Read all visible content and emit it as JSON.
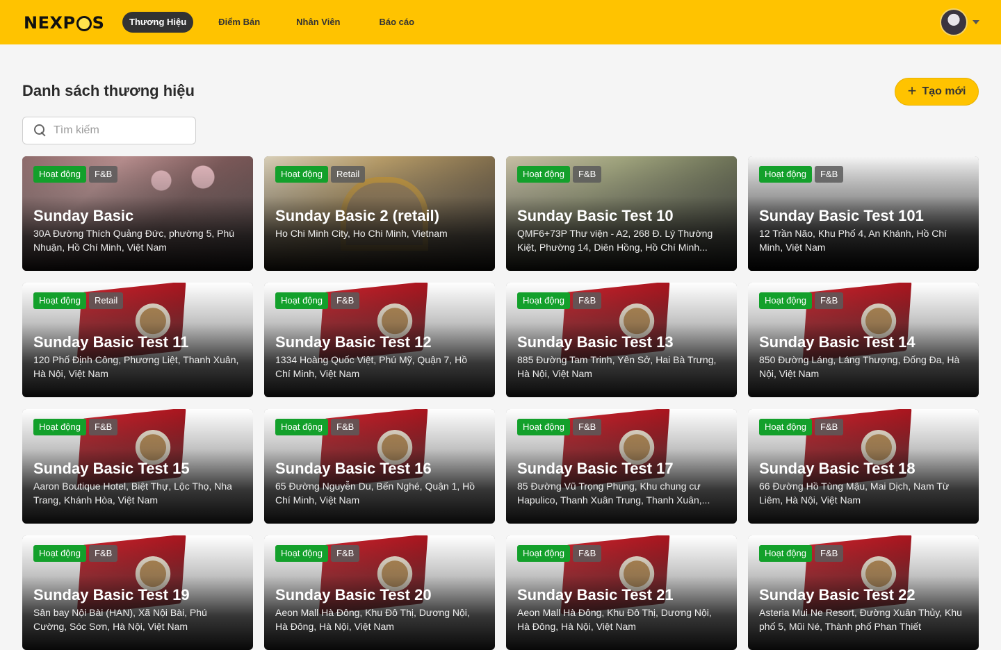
{
  "app": {
    "logo_text_1": "NEXP",
    "logo_text_2": "S"
  },
  "nav": {
    "items": [
      {
        "label": "Thương Hiệu",
        "active": true
      },
      {
        "label": "Điểm Bán",
        "active": false
      },
      {
        "label": "Nhân Viên",
        "active": false
      },
      {
        "label": "Báo cáo",
        "active": false
      }
    ]
  },
  "page": {
    "title": "Danh sách thương hiệu",
    "create_label": "Tạo mới",
    "create_icon": "+"
  },
  "search": {
    "placeholder": "Tìm kiếm",
    "value": ""
  },
  "colors": {
    "accent": "#ffc300",
    "status_active": "#13a02b",
    "nav_active_bg": "#333333"
  },
  "brands": [
    {
      "status": "Hoạt động",
      "type": "F&B",
      "name": "Sunday Basic",
      "address": "30A Đường Thích Quảng Đức, phường 5, Phú Nhuận, Hồ Chí Minh, Việt Nam",
      "image": "interior"
    },
    {
      "status": "Hoạt động",
      "type": "Retail",
      "name": "Sunday Basic 2 (retail)",
      "address": "Ho Chi Minh City, Ho Chi Minh, Vietnam",
      "image": "store"
    },
    {
      "status": "Hoạt động",
      "type": "F&B",
      "name": "Sunday Basic Test 10",
      "address": "QMF6+73P Thư viện - A2, 268 Đ. Lý Thường Kiệt, Phường 14, Diên Hồng, Hồ Chí Minh...",
      "image": "cafe"
    },
    {
      "status": "Hoạt động",
      "type": "F&B",
      "name": "Sunday Basic Test 101",
      "address": "12 Trần Não, Khu Phố 4, An Khánh, Hồ Chí Minh, Việt Nam",
      "image": "grey"
    },
    {
      "status": "Hoạt động",
      "type": "Retail",
      "name": "Sunday Basic Test 11",
      "address": "120 Phố Định Công, Phương Liệt, Thanh Xuân, Hà Nội, Việt Nam",
      "image": "coffee"
    },
    {
      "status": "Hoạt động",
      "type": "F&B",
      "name": "Sunday Basic Test 12",
      "address": "1334 Hoàng Quốc Việt, Phú Mỹ, Quận 7, Hồ Chí Minh, Việt Nam",
      "image": "coffee"
    },
    {
      "status": "Hoạt động",
      "type": "F&B",
      "name": "Sunday Basic Test 13",
      "address": "885 Đường Tam Trinh, Yên Sở, Hai Bà Trưng, Hà Nội, Việt Nam",
      "image": "coffee"
    },
    {
      "status": "Hoạt động",
      "type": "F&B",
      "name": "Sunday Basic Test 14",
      "address": "850 Đường Láng, Láng Thượng, Đống Đa, Hà Nội, Việt Nam",
      "image": "coffee"
    },
    {
      "status": "Hoạt động",
      "type": "F&B",
      "name": "Sunday Basic Test 15",
      "address": "Aaron Boutique Hotel, Biệt Thự, Lộc Thọ, Nha Trang, Khánh Hòa, Việt Nam",
      "image": "coffee"
    },
    {
      "status": "Hoạt động",
      "type": "F&B",
      "name": "Sunday Basic Test 16",
      "address": "65 Đường Nguyễn Du, Bến Nghé, Quận 1, Hồ Chí Minh, Việt Nam",
      "image": "coffee"
    },
    {
      "status": "Hoạt động",
      "type": "F&B",
      "name": "Sunday Basic Test 17",
      "address": "85 Đường Vũ Trọng Phụng, Khu chung cư Hapulico, Thanh Xuân Trung, Thanh Xuân,...",
      "image": "coffee"
    },
    {
      "status": "Hoạt động",
      "type": "F&B",
      "name": "Sunday Basic Test 18",
      "address": "66 Đường Hồ Tùng Mậu, Mai Dịch, Nam Từ Liêm, Hà Nội, Việt Nam",
      "image": "coffee"
    },
    {
      "status": "Hoạt động",
      "type": "F&B",
      "name": "Sunday Basic Test 19",
      "address": "Sân bay Nội Bài (HAN), Xã Nội Bài, Phú Cường, Sóc Sơn, Hà Nội, Việt Nam",
      "image": "coffee"
    },
    {
      "status": "Hoạt động",
      "type": "F&B",
      "name": "Sunday Basic Test 20",
      "address": "Aeon Mall Hà Đông, Khu Đô Thị, Dương Nội, Hà Đông, Hà Nội, Việt Nam",
      "image": "coffee"
    },
    {
      "status": "Hoạt động",
      "type": "F&B",
      "name": "Sunday Basic Test 21",
      "address": "Aeon Mall Hà Đông, Khu Đô Thị, Dương Nội, Hà Đông, Hà Nội, Việt Nam",
      "image": "coffee"
    },
    {
      "status": "Hoạt động",
      "type": "F&B",
      "name": "Sunday Basic Test 22",
      "address": "Asteria Mui Ne Resort, Đường Xuân Thủy, Khu phố 5, Mũi Né, Thành phố Phan Thiết",
      "image": "coffee"
    }
  ]
}
